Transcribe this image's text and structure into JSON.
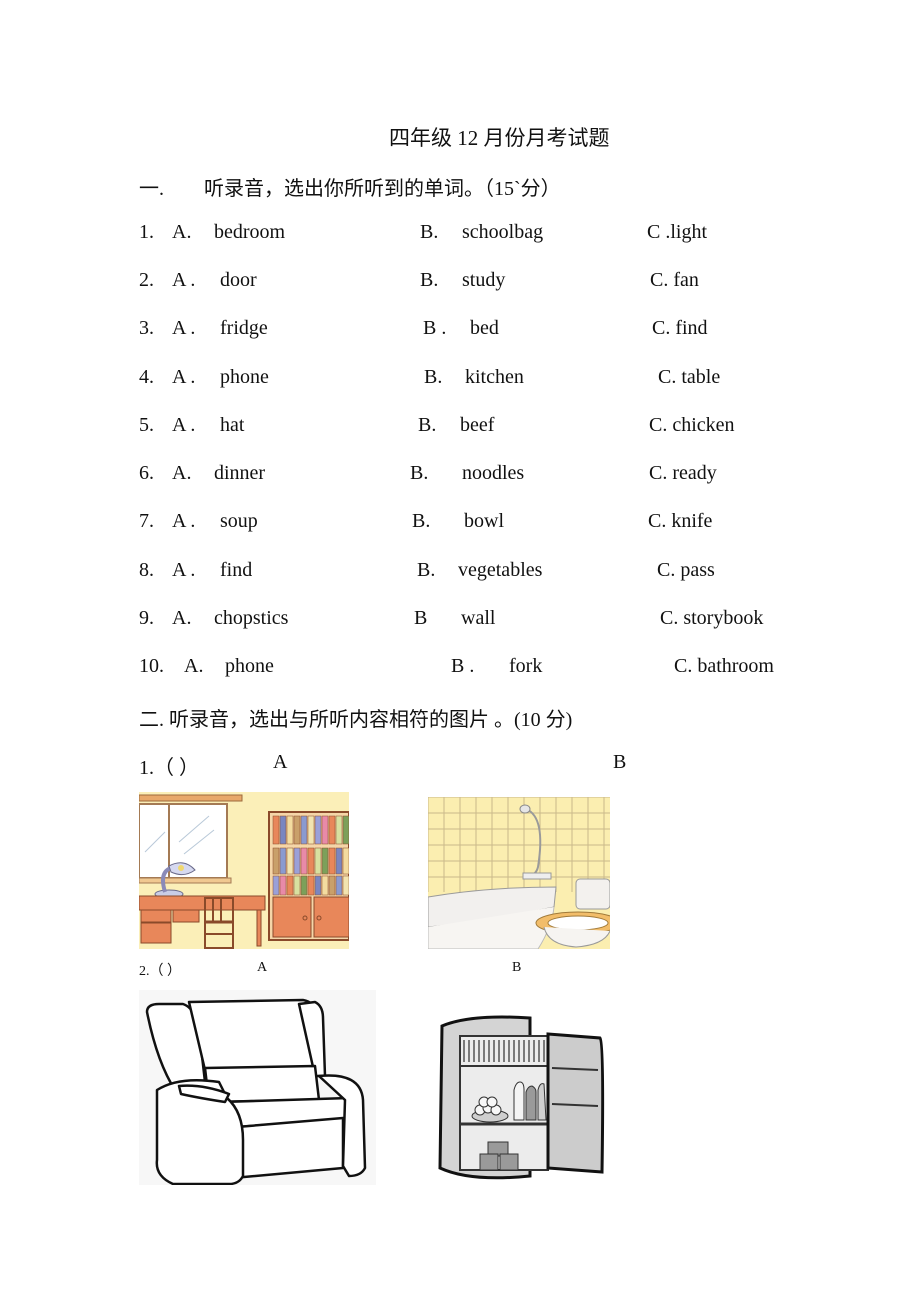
{
  "title": "四年级 12 月份月考试题",
  "section1": {
    "heading_num": "一.",
    "heading_text": "听录音，选出你所听到的单词。（15`分）",
    "rows": [
      {
        "num": "1.",
        "a_label": "A.",
        "a": "bedroom",
        "b_label": "B.",
        "b": "schoolbag",
        "c": "C .light"
      },
      {
        "num": "2.",
        "a_label": "A .",
        "a": "door",
        "b_label": "B.",
        "b": "study",
        "c": "C. fan"
      },
      {
        "num": "3.",
        "a_label": "A .",
        "a": "fridge",
        "b_label": "B .",
        "b": "bed",
        "c": "C. find"
      },
      {
        "num": "4.",
        "a_label": "A .",
        "a": "phone",
        "b_label": "B.",
        "b": "kitchen",
        "c": "C. table"
      },
      {
        "num": "5.",
        "a_label": "A .",
        "a": "hat",
        "b_label": "B.",
        "b": "beef",
        "c": "C. chicken"
      },
      {
        "num": "6.",
        "a_label": "A.",
        "a": "dinner",
        "b_label": "B.",
        "b": "noodles",
        "c": "C. ready"
      },
      {
        "num": "7.",
        "a_label": "A .",
        "a": "soup",
        "b_label": "B.",
        "b": "bowl",
        "c": "C. knife"
      },
      {
        "num": "8.",
        "a_label": "A .",
        "a": "find",
        "b_label": "B.",
        "b": "vegetables",
        "c": "C. pass"
      },
      {
        "num": "9.",
        "a_label": "A.",
        "a": "chopstics",
        "b_label": "B",
        "b": "wall",
        "c": "C. storybook"
      },
      {
        "num": "10.",
        "a_label": "A.",
        "a": "phone",
        "b_label": "B .",
        "b": "fork",
        "c": "C. bathroom"
      }
    ]
  },
  "section2": {
    "heading": "二. 听录音，选出与所听内容相符的图片 。(10 分)",
    "questions": [
      {
        "label": "1.（    ）",
        "option_a": "A",
        "option_b": "B",
        "image_a": "study-room-illustration",
        "image_b": "bathroom-illustration"
      },
      {
        "label": "2.（    ）",
        "option_a": "A",
        "option_b": "B",
        "image_a": "armchair-sofa-illustration",
        "image_b": "fridge-illustration"
      }
    ]
  }
}
